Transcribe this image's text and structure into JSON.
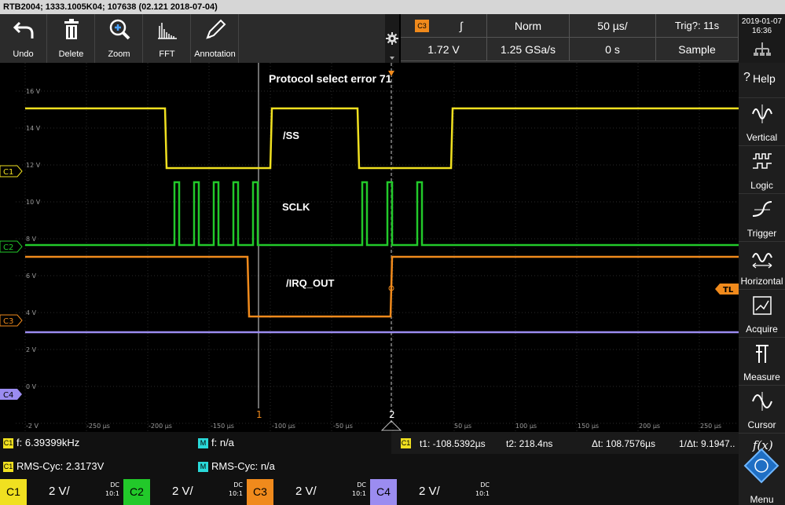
{
  "title": "RTB2004; 1333.1005K04; 107638 (02.121 2018-07-04)",
  "toolbar": [
    {
      "label": "Undo",
      "icon": "undo-icon"
    },
    {
      "label": "Delete",
      "icon": "trash-icon"
    },
    {
      "label": "Zoom",
      "icon": "zoom-icon"
    },
    {
      "label": "FFT",
      "icon": "fft-icon"
    },
    {
      "label": "Annotation",
      "icon": "pen-icon"
    }
  ],
  "trigger": {
    "source": "C3",
    "slope": "∫",
    "mode": "Norm",
    "timebase": "50 µs/",
    "trig_status": "Trig?: 11s",
    "level": "1.72 V",
    "sample_rate": "1.25 GSa/s",
    "position": "0 s",
    "acq_mode": "Sample"
  },
  "datetime": {
    "date": "2019-01-07",
    "time": "16:36"
  },
  "side_menu": [
    {
      "label": "Help",
      "icon": "help-icon"
    },
    {
      "label": "Vertical",
      "icon": "vertical-icon"
    },
    {
      "label": "Logic",
      "icon": "logic-icon"
    },
    {
      "label": "Trigger",
      "icon": "trigger-icon"
    },
    {
      "label": "Horizontal",
      "icon": "horizontal-icon"
    },
    {
      "label": "Acquire",
      "icon": "acquire-icon"
    },
    {
      "label": "Measure",
      "icon": "measure-icon"
    },
    {
      "label": "Cursor",
      "icon": "cursor-icon"
    }
  ],
  "func_label": "f(x)",
  "menu_label": "Menu",
  "plot": {
    "error": "Protocol select error 71",
    "labels": {
      "ss": "/SS",
      "sclk": "SCLK",
      "irq": "/IRQ_OUT"
    },
    "y_ticks": [
      "16 V",
      "14 V",
      "12 V",
      "10 V",
      "8 V",
      "6 V",
      "4 V",
      "2 V",
      "0 V"
    ],
    "x_ticks": [
      "-2 V",
      "-250 µs",
      "-200 µs",
      "-150 µs",
      "-100 µs",
      "-50 µs",
      "50 µs",
      "100 µs",
      "150 µs",
      "200 µs",
      "250 µs"
    ],
    "ch_markers": [
      "C1",
      "C2",
      "C3",
      "C4"
    ],
    "tl": "TL",
    "cursor1": "1",
    "cursor2": "2"
  },
  "measurements": {
    "c1_freq": "f: 6.39399kHz",
    "c1_rms": "RMS-Cyc: 2.3173V",
    "m_freq": "f: n/a",
    "m_rms": "RMS-Cyc: n/a",
    "t1": "t1: -108.5392µs",
    "t2": "t2: 218.4ns",
    "dt": "Δt: 108.7576µs",
    "inv_dt": "1/Δt: 9.1947.."
  },
  "channels": [
    {
      "name": "C1",
      "value": "2 V/",
      "coupling": "DC",
      "ratio": "10:1",
      "color": "#f0e020"
    },
    {
      "name": "C2",
      "value": "2 V/",
      "coupling": "DC",
      "ratio": "10:1",
      "color": "#22c92a"
    },
    {
      "name": "C3",
      "value": "2 V/",
      "coupling": "DC",
      "ratio": "10:1",
      "color": "#f08a1c"
    },
    {
      "name": "C4",
      "value": "2 V/",
      "coupling": "DC",
      "ratio": "10:1",
      "color": "#9b8cf0"
    }
  ],
  "colors": {
    "c1": "#f0e020",
    "c2": "#22c92a",
    "c3": "#f08a1c",
    "c4": "#9b8cf0",
    "m": "#2ad9d9"
  }
}
